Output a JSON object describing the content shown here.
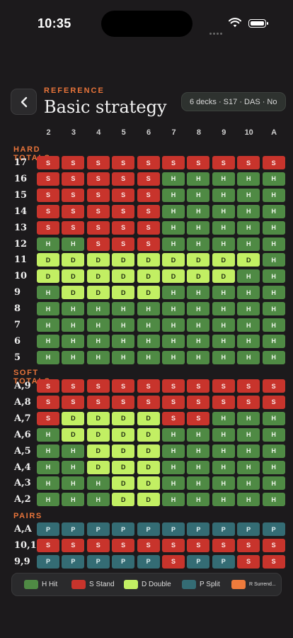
{
  "status": {
    "time": "10:35"
  },
  "header": {
    "eyebrow": "REFERENCE",
    "title": "Basic strategy",
    "config": "6 decks · S17 · DAS · No"
  },
  "columns": [
    "2",
    "3",
    "4",
    "5",
    "6",
    "7",
    "8",
    "9",
    "10",
    "A"
  ],
  "sections": [
    {
      "label": "HARD TOTALS",
      "rows": [
        {
          "label": "17",
          "cells": [
            "S",
            "S",
            "S",
            "S",
            "S",
            "S",
            "S",
            "S",
            "S",
            "S"
          ]
        },
        {
          "label": "16",
          "cells": [
            "S",
            "S",
            "S",
            "S",
            "S",
            "H",
            "H",
            "H",
            "H",
            "H"
          ]
        },
        {
          "label": "15",
          "cells": [
            "S",
            "S",
            "S",
            "S",
            "S",
            "H",
            "H",
            "H",
            "H",
            "H"
          ]
        },
        {
          "label": "14",
          "cells": [
            "S",
            "S",
            "S",
            "S",
            "S",
            "H",
            "H",
            "H",
            "H",
            "H"
          ]
        },
        {
          "label": "13",
          "cells": [
            "S",
            "S",
            "S",
            "S",
            "S",
            "H",
            "H",
            "H",
            "H",
            "H"
          ]
        },
        {
          "label": "12",
          "cells": [
            "H",
            "H",
            "S",
            "S",
            "S",
            "H",
            "H",
            "H",
            "H",
            "H"
          ]
        },
        {
          "label": "11",
          "cells": [
            "D",
            "D",
            "D",
            "D",
            "D",
            "D",
            "D",
            "D",
            "D",
            "H"
          ]
        },
        {
          "label": "10",
          "cells": [
            "D",
            "D",
            "D",
            "D",
            "D",
            "D",
            "D",
            "D",
            "H",
            "H"
          ]
        },
        {
          "label": "9",
          "cells": [
            "H",
            "D",
            "D",
            "D",
            "D",
            "H",
            "H",
            "H",
            "H",
            "H"
          ]
        },
        {
          "label": "8",
          "cells": [
            "H",
            "H",
            "H",
            "H",
            "H",
            "H",
            "H",
            "H",
            "H",
            "H"
          ]
        },
        {
          "label": "7",
          "cells": [
            "H",
            "H",
            "H",
            "H",
            "H",
            "H",
            "H",
            "H",
            "H",
            "H"
          ]
        },
        {
          "label": "6",
          "cells": [
            "H",
            "H",
            "H",
            "H",
            "H",
            "H",
            "H",
            "H",
            "H",
            "H"
          ]
        },
        {
          "label": "5",
          "cells": [
            "H",
            "H",
            "H",
            "H",
            "H",
            "H",
            "H",
            "H",
            "H",
            "H"
          ]
        }
      ]
    },
    {
      "label": "SOFT TOTALS",
      "rows": [
        {
          "label": "A,9",
          "cells": [
            "S",
            "S",
            "S",
            "S",
            "S",
            "S",
            "S",
            "S",
            "S",
            "S"
          ]
        },
        {
          "label": "A,8",
          "cells": [
            "S",
            "S",
            "S",
            "S",
            "S",
            "S",
            "S",
            "S",
            "S",
            "S"
          ]
        },
        {
          "label": "A,7",
          "cells": [
            "S",
            "D",
            "D",
            "D",
            "D",
            "S",
            "S",
            "H",
            "H",
            "H"
          ]
        },
        {
          "label": "A,6",
          "cells": [
            "H",
            "D",
            "D",
            "D",
            "D",
            "H",
            "H",
            "H",
            "H",
            "H"
          ]
        },
        {
          "label": "A,5",
          "cells": [
            "H",
            "H",
            "D",
            "D",
            "D",
            "H",
            "H",
            "H",
            "H",
            "H"
          ]
        },
        {
          "label": "A,4",
          "cells": [
            "H",
            "H",
            "D",
            "D",
            "D",
            "H",
            "H",
            "H",
            "H",
            "H"
          ]
        },
        {
          "label": "A,3",
          "cells": [
            "H",
            "H",
            "H",
            "D",
            "D",
            "H",
            "H",
            "H",
            "H",
            "H"
          ]
        },
        {
          "label": "A,2",
          "cells": [
            "H",
            "H",
            "H",
            "D",
            "D",
            "H",
            "H",
            "H",
            "H",
            "H"
          ]
        }
      ]
    },
    {
      "label": "PAIRS",
      "rows": [
        {
          "label": "A,A",
          "cells": [
            "P",
            "P",
            "P",
            "P",
            "P",
            "P",
            "P",
            "P",
            "P",
            "P"
          ]
        },
        {
          "label": "10,10",
          "cells": [
            "S",
            "S",
            "S",
            "S",
            "S",
            "S",
            "S",
            "S",
            "S",
            "S"
          ]
        },
        {
          "label": "9,9",
          "cells": [
            "P",
            "P",
            "P",
            "P",
            "P",
            "S",
            "P",
            "P",
            "S",
            "S"
          ]
        }
      ]
    }
  ],
  "legend": [
    {
      "code": "H",
      "label": "H Hit"
    },
    {
      "code": "S",
      "label": "S Stand"
    },
    {
      "code": "D",
      "label": "D Double"
    },
    {
      "code": "P",
      "label": "P Split"
    },
    {
      "code": "R",
      "label": "R Surrend..."
    }
  ],
  "colors": {
    "hit": "#4f8a44",
    "stand": "#c8342c",
    "double": "#c2ef63",
    "split": "#346c74",
    "surrender": "#ee7b3c",
    "accent": "#e8743a"
  },
  "icons": {
    "back": "chevron-left-icon",
    "wifi": "wifi-icon",
    "battery": "battery-icon",
    "signal": "signal-dots-icon"
  }
}
